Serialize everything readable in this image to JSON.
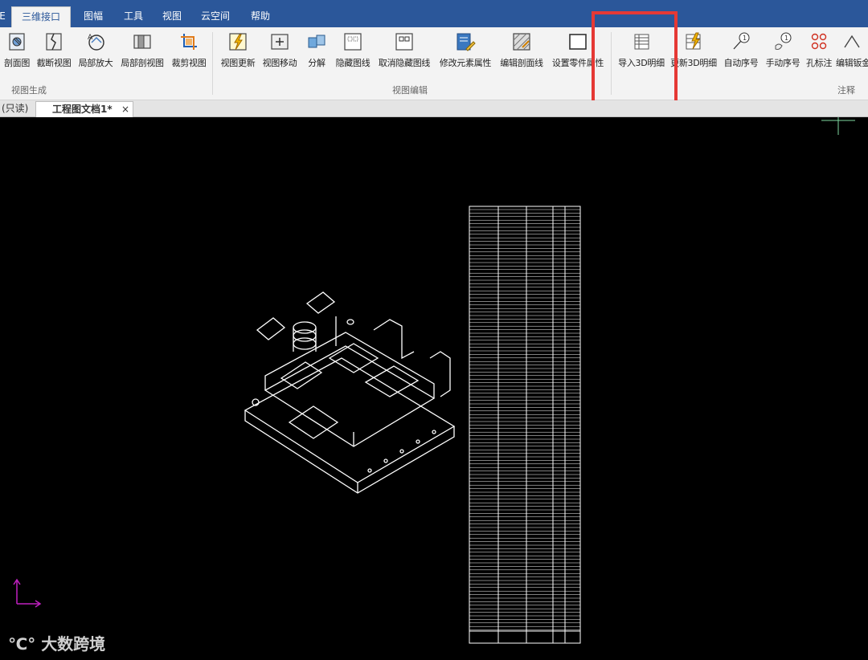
{
  "menubar": {
    "items": [
      {
        "label": "E"
      },
      {
        "label": "三维接口"
      },
      {
        "label": "图幅"
      },
      {
        "label": "工具"
      },
      {
        "label": "视图"
      },
      {
        "label": "云空间"
      },
      {
        "label": "帮助"
      }
    ],
    "active_index": 1
  },
  "ribbon": {
    "groups": [
      {
        "label": "视图生成"
      },
      {
        "label": "视图编辑"
      },
      {
        "label": "注释"
      }
    ],
    "buttons": [
      {
        "label": "剖面图",
        "icon": "section-view-icon"
      },
      {
        "label": "截断视图",
        "icon": "break-view-icon"
      },
      {
        "label": "局部放大",
        "icon": "detail-view-icon"
      },
      {
        "label": "局部剖视图",
        "icon": "partial-section-icon"
      },
      {
        "label": "裁剪视图",
        "icon": "crop-view-icon"
      },
      {
        "label": "视图更新",
        "icon": "view-update-icon"
      },
      {
        "label": "视图移动",
        "icon": "view-move-icon"
      },
      {
        "label": "分解",
        "icon": "explode-icon"
      },
      {
        "label": "隐藏图线",
        "icon": "hide-lines-icon"
      },
      {
        "label": "取消隐藏图线",
        "icon": "unhide-lines-icon"
      },
      {
        "label": "修改元素属性",
        "icon": "edit-properties-icon"
      },
      {
        "label": "编辑剖面线",
        "icon": "edit-hatch-icon"
      },
      {
        "label": "设置零件属性",
        "icon": "part-properties-icon"
      },
      {
        "label": "导入3D明细",
        "icon": "import-3d-bom-icon"
      },
      {
        "label": "更新3D明细",
        "icon": "update-3d-bom-icon"
      },
      {
        "label": "自动序号",
        "icon": "auto-balloon-icon"
      },
      {
        "label": "手动序号",
        "icon": "manual-balloon-icon"
      },
      {
        "label": "孔标注",
        "icon": "hole-callout-icon"
      },
      {
        "label": "编辑钣金",
        "icon": "edit-sheetmetal-icon"
      }
    ]
  },
  "tabs": {
    "readonly_tab": "(只读)",
    "doc_tab": "工程图文档1*",
    "close_glyph": "×"
  },
  "colors": {
    "titlebar": "#2b579a",
    "ribbon_bg": "#f3f3f3",
    "canvas": "#000000",
    "highlight": "#e53935",
    "drawing_lines": "#ffffff",
    "ucs_axes": "#c020c0",
    "crosshair": "#7fd8a0"
  },
  "watermark": {
    "text": "大数跨境"
  }
}
